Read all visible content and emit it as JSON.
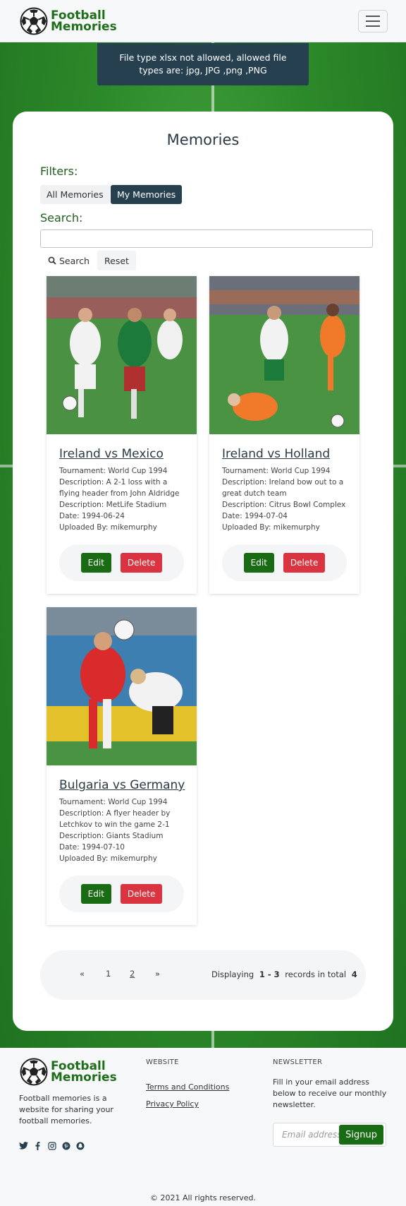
{
  "nav": {
    "brand_line1": "Football",
    "brand_line2": "Memories",
    "menu_icon": "hamburger-icon"
  },
  "alert": {
    "message": "File type xlsx not allowed, allowed file types are: jpg, JPG ,png ,PNG"
  },
  "main": {
    "title": "Memories",
    "filters_label": "Filters:",
    "filter_all": "All Memories",
    "filter_my": "My Memories",
    "search_label": "Search:",
    "search_value": "",
    "search_button": "Search",
    "reset_button": "Reset"
  },
  "cards": [
    {
      "title": "Ireland vs Mexico",
      "tournament": "Tournament: World Cup 1994",
      "description": "Description: A 2-1 loss with a flying header from John Aldridge",
      "venue": "Description: MetLife Stadium",
      "date": "Date: 1994-06-24",
      "uploaded": "Uploaded By: mikemurphy",
      "edit": "Edit",
      "delete": "Delete"
    },
    {
      "title": "Ireland vs Holland",
      "tournament": "Tournament: World Cup 1994",
      "description": "Description: Ireland bow out to a great dutch team",
      "venue": "Description: Citrus Bowl Complex",
      "date": "Date: 1994-07-04",
      "uploaded": "Uploaded By: mikemurphy",
      "edit": "Edit",
      "delete": "Delete"
    },
    {
      "title": "Bulgaria vs Germany",
      "tournament": "Tournament: World Cup 1994",
      "description": "Description: A flyer header by Letchkov to win the game 2-1",
      "venue": "Description: Giants Stadium",
      "date": "Date: 1994-07-10",
      "uploaded": "Uploaded By: mikemurphy",
      "edit": "Edit",
      "delete": "Delete"
    }
  ],
  "pagination": {
    "prev": "«",
    "page1": "1",
    "page2": "2",
    "next": "»",
    "displaying": "Displaying",
    "range": "1 - 3",
    "records_in_total": "records in total",
    "total": "4"
  },
  "footer": {
    "brand_line1": "Football",
    "brand_line2": "Memories",
    "description": "Football memories is a website for sharing your football memories.",
    "website_heading": "WEBSITE",
    "terms": "Terms and Conditions",
    "privacy": "Privacy Policy",
    "newsletter_heading": "NEWSLETTER",
    "newsletter_text": "Fill in your email address below to receive our monthly newsletter.",
    "email_placeholder": "Email address",
    "signup": "Signup",
    "copyright": "© 2021 All rights reserved.",
    "social_icons": [
      "twitter-icon",
      "facebook-icon",
      "instagram-icon",
      "pinterest-icon",
      "snapchat-icon"
    ]
  },
  "colors": {
    "brand_green": "#1f6f1a",
    "navy": "#26404f",
    "edit_green": "#196b14",
    "delete_red": "#d9343f"
  }
}
